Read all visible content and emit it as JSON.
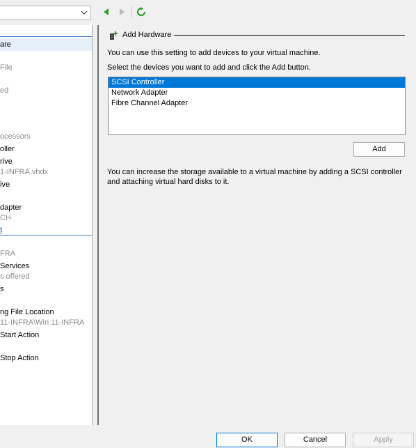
{
  "toolbar": {
    "back_icon": "back-arrow-icon",
    "forward_icon": "forward-arrow-icon",
    "refresh_icon": "refresh-icon"
  },
  "left": {
    "items": [
      {
        "text": "are",
        "style": "selected"
      },
      {
        "text": "File",
        "style": "gray"
      },
      {
        "text": "ed",
        "style": "gray"
      },
      {
        "text": "ocessors",
        "style": "gray"
      },
      {
        "text": "oller",
        "style": "normal"
      },
      {
        "text": "rive",
        "style": "normal"
      },
      {
        "text": "1-INFRA.vhdx",
        "style": "gray"
      },
      {
        "text": "ive",
        "style": "normal"
      },
      {
        "text": "dapter",
        "style": "normal"
      },
      {
        "text": "CH",
        "style": "gray"
      },
      {
        "text": "t",
        "style": "link"
      },
      {
        "text": "FRA",
        "style": "gray"
      },
      {
        "text": " Services",
        "style": "normal"
      },
      {
        "text": "s offered",
        "style": "gray"
      },
      {
        "text": "s",
        "style": "normal"
      },
      {
        "text": "ng File Location",
        "style": "normal"
      },
      {
        "text": "11-INFRA\\Win 11-INFRA",
        "style": "gray"
      },
      {
        "text": "Start Action",
        "style": "normal"
      },
      {
        "text": "Stop Action",
        "style": "normal"
      }
    ]
  },
  "panel": {
    "title": "Add Hardware",
    "info1": "You can use this setting to add devices to your virtual machine.",
    "info2": "Select the devices you want to add and click the Add button.",
    "devices": [
      "SCSI Controller",
      "Network Adapter",
      "Fibre Channel Adapter"
    ],
    "selected_device": 0,
    "add_label": "Add",
    "description": "You can increase the storage available to a virtual machine by adding a SCSI controller and attaching virtual hard disks to it."
  },
  "footer": {
    "ok_label": "OK",
    "cancel_label": "Cancel",
    "apply_label": "Apply"
  },
  "colors": {
    "accent": "#0078d7",
    "nav_green": "#2aa12a"
  }
}
